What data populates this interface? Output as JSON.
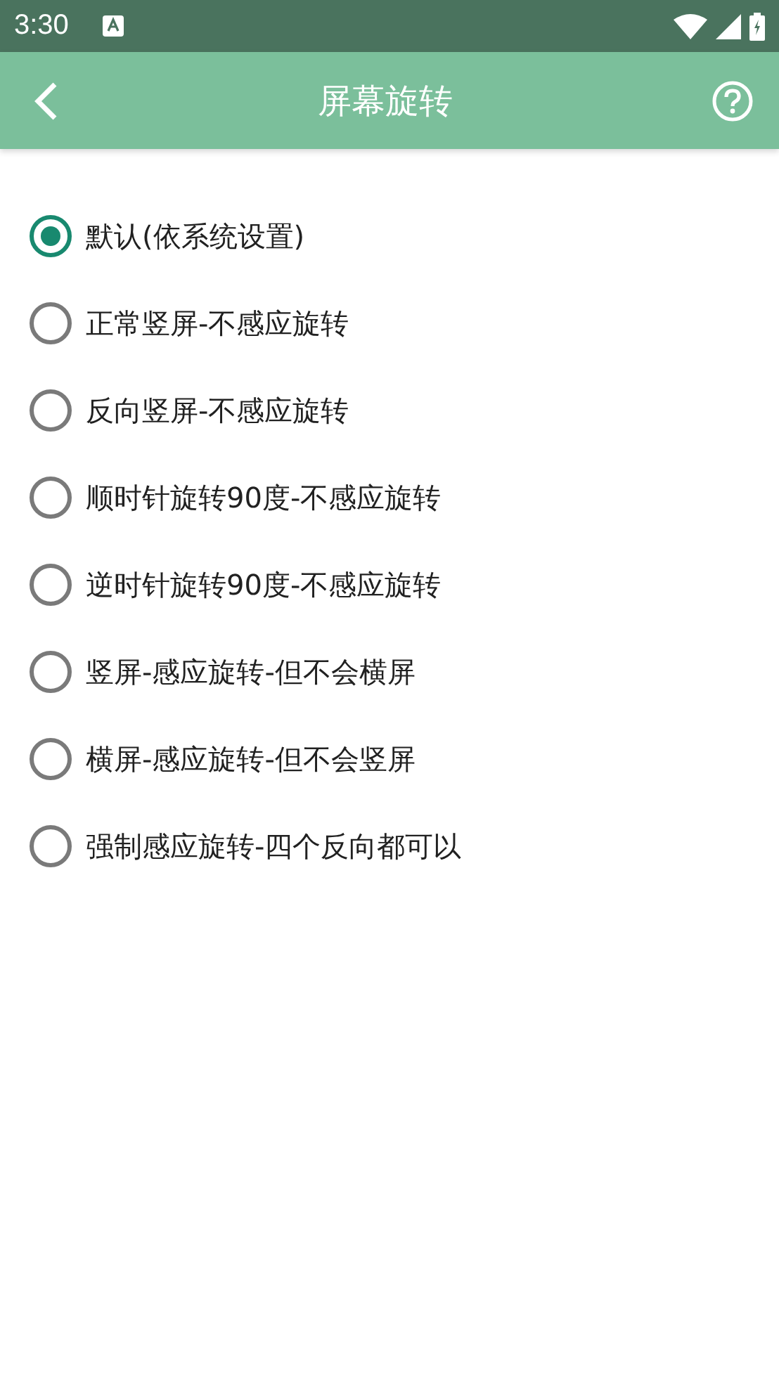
{
  "status_bar": {
    "time": "3:30"
  },
  "toolbar": {
    "title": "屏幕旋转"
  },
  "options": [
    {
      "label": "默认(依系统设置)",
      "selected": true
    },
    {
      "label": "正常竖屏-不感应旋转",
      "selected": false
    },
    {
      "label": "反向竖屏-不感应旋转",
      "selected": false
    },
    {
      "label": "顺时针旋转90度-不感应旋转",
      "selected": false
    },
    {
      "label": "逆时针旋转90度-不感应旋转",
      "selected": false
    },
    {
      "label": "竖屏-感应旋转-但不会横屏",
      "selected": false
    },
    {
      "label": "横屏-感应旋转-但不会竖屏",
      "selected": false
    },
    {
      "label": "强制感应旋转-四个反向都可以",
      "selected": false
    }
  ]
}
